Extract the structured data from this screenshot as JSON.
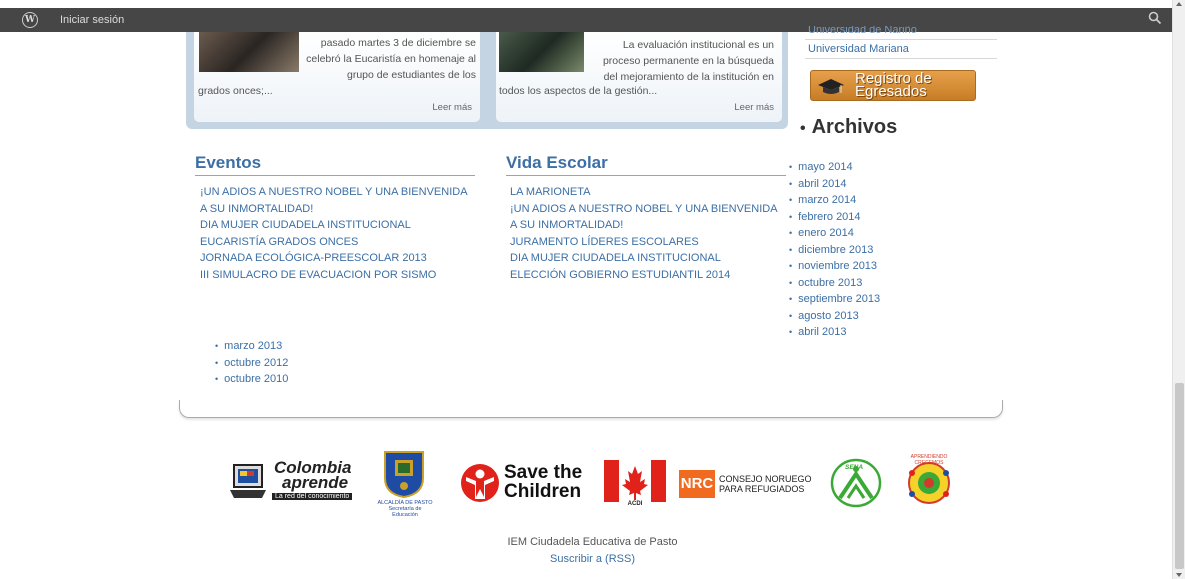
{
  "admin_bar": {
    "login_label": "Iniciar sesión",
    "wp_glyph": "W",
    "search_icon": "search-icon"
  },
  "news": [
    {
      "text_top": "pasado martes 3 de diciembre se celebró la Eucaristía en homenaje al grupo de estudiantes de los",
      "text_bottom": "grados onces;...",
      "read_more": "Leer más"
    },
    {
      "text_top": "La evaluación institucional es un proceso permanente en la búsqueda del mejoramiento de la institución en",
      "text_bottom": "todos los aspectos de la gestión...",
      "read_more": "Leer más"
    }
  ],
  "sidebar": {
    "links": [
      "Universidad de Nariño",
      "Universidad Mariana"
    ],
    "registro_label_1": "Registro de",
    "registro_label_2": "Egresados",
    "archivos_title": "Archivos",
    "archivos": [
      "mayo 2014",
      "abril 2014",
      "marzo 2014",
      "febrero 2014",
      "enero 2014",
      "diciembre 2013",
      "noviembre 2013",
      "octubre 2013",
      "septiembre 2013",
      "agosto 2013",
      "abril 2013"
    ]
  },
  "eventos": {
    "title": "Eventos",
    "items": [
      "¡UN ADIOS A NUESTRO NOBEL Y UNA BIENVENIDA",
      "A SU INMORTALIDAD!",
      "DIA MUJER CIUDADELA INSTITUCIONAL",
      "EUCARISTÍA GRADOS ONCES",
      "JORNADA ECOLÓGICA-PREESCOLAR 2013",
      "III SIMULACRO DE EVACUACION POR SISMO"
    ]
  },
  "vida_escolar": {
    "title": "Vida Escolar",
    "items": [
      "LA MARIONETA",
      "¡UN ADIOS A NUESTRO NOBEL Y UNA BIENVENIDA",
      "A SU INMORTALIDAD!",
      "JURAMENTO LÍDERES ESCOLARES",
      "DIA MUJER CIUDADELA INSTITUCIONAL",
      "ELECCIÓN GOBIERNO ESTUDIANTIL 2014"
    ]
  },
  "older_archives": [
    "marzo 2013",
    "octubre 2012",
    "octubre 2010"
  ],
  "logos": {
    "colombia_1": "Colombia",
    "colombia_2": "aprende",
    "colombia_3": "La red del conocimiento",
    "alcaldia_1": "ALCALDÍA DE PASTO",
    "alcaldia_2": "Secretaría de Educación",
    "save_1": "Save the",
    "save_2": "Children",
    "acdi": "ACDI",
    "nrc": "NRC",
    "nrc_1": "CONSEJO NORUEGO",
    "nrc_2": "PARA REFUGIADOS",
    "sena": "SENA",
    "aprendiendo": "APRENDIENDO CRECEMOS"
  },
  "footer": {
    "site_name": "IEM Ciudadela Educativa de Pasto",
    "rss": "Suscribir a (RSS)"
  },
  "colors": {
    "link": "#3c6fa5",
    "admin_bar": "#464646",
    "news_bg": "#c5d4e2",
    "registro": "#d98d36"
  }
}
